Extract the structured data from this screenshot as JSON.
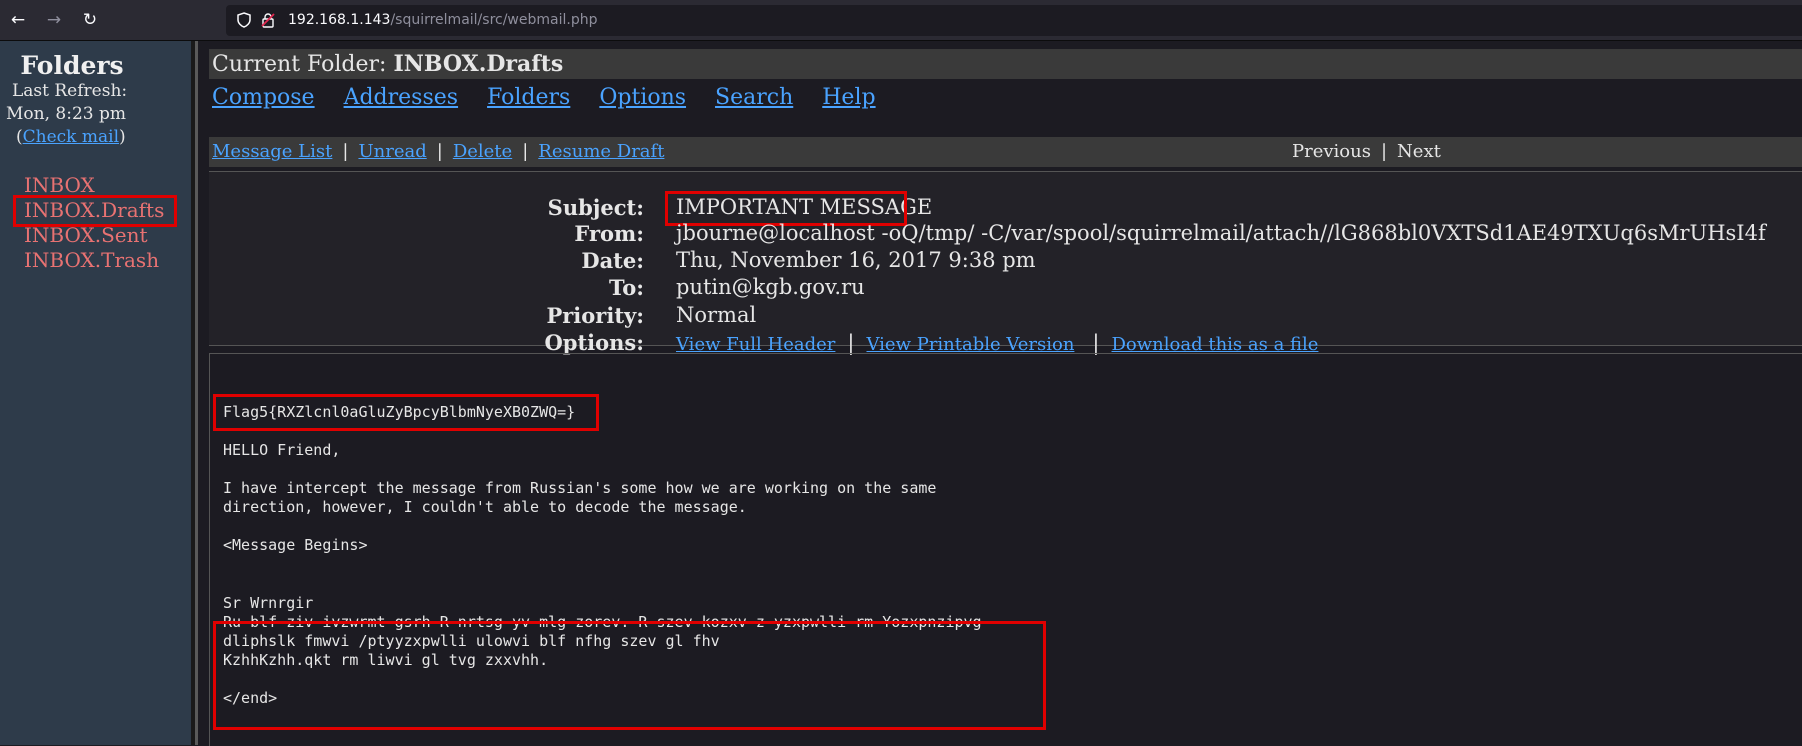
{
  "browser": {
    "url_host": "192.168.1.143",
    "url_path": "/squirrelmail/src/webmail.php",
    "back_icon": "←",
    "forward_icon": "→",
    "reload_icon": "↻"
  },
  "sidebar": {
    "title": "Folders",
    "last_refresh_label": "Last  Refresh:",
    "last_refresh_time": "Mon,  8:23  pm",
    "check_mail_open": "(",
    "check_mail_label": "Check mail",
    "check_mail_close": ")",
    "folders": [
      "INBOX",
      "INBOX.Drafts",
      "INBOX.Sent",
      "INBOX.Trash"
    ]
  },
  "main": {
    "current_folder_label": "Current Folder: ",
    "current_folder_name": "INBOX.Drafts",
    "nav": [
      "Compose",
      "Addresses",
      "Folders",
      "Options",
      "Search",
      "Help"
    ],
    "message_actions": [
      "Message List",
      "Unread",
      "Delete",
      "Resume Draft"
    ],
    "separator": "|",
    "previous_label": "Previous",
    "next_label": "Next"
  },
  "headers": {
    "subject_label": "Subject:",
    "subject": "IMPORTANT MESSAGE",
    "from_label": "From:",
    "from": "jbourne@localhost -oQ/tmp/ -C/var/spool/squirrelmail/attach//lG868bl0VXTSd1AE49TXUq6sMrUHsI4f",
    "date_label": "Date:",
    "date": "Thu, November 16, 2017 9:38 pm",
    "to_label": "To:",
    "to": "putin@kgb.gov.ru",
    "priority_label": "Priority:",
    "priority": "Normal",
    "options_label": "Options:",
    "options": [
      "View Full Header",
      "View Printable Version",
      "Download this as a file"
    ]
  },
  "message": {
    "flag": "Flag5{RXZlcnl0aGluZyBpcyBlbmNyeXB0ZWQ=}",
    "greeting": "HELLO Friend,",
    "paragraph_line1": "I have intercept the message from Russian's some how we are working on the same",
    "paragraph_line2": "direction, however, I couldn't able to decode the message.",
    "begins": "<Message Begins>",
    "cipher_line1": "Sr Wrnrgir",
    "cipher_line2": "Ru blf ziv ivzwrmt gsrh R nrtsg yv mlg zorev. R szev kozxv z yzxpwlli rm Yozxpnzipvg",
    "cipher_line3": "dliphslk fmwvi /ptyyzxpwlli ulowvi blf nfhg szev gl fhv",
    "cipher_line4": "KzhhKzhh.qkt rm liwvi gl tvg zxxvhh.",
    "end": "</end>"
  },
  "colors": {
    "highlight": "#e00000",
    "link": "#4aa3ff",
    "folder": "#e87272"
  }
}
